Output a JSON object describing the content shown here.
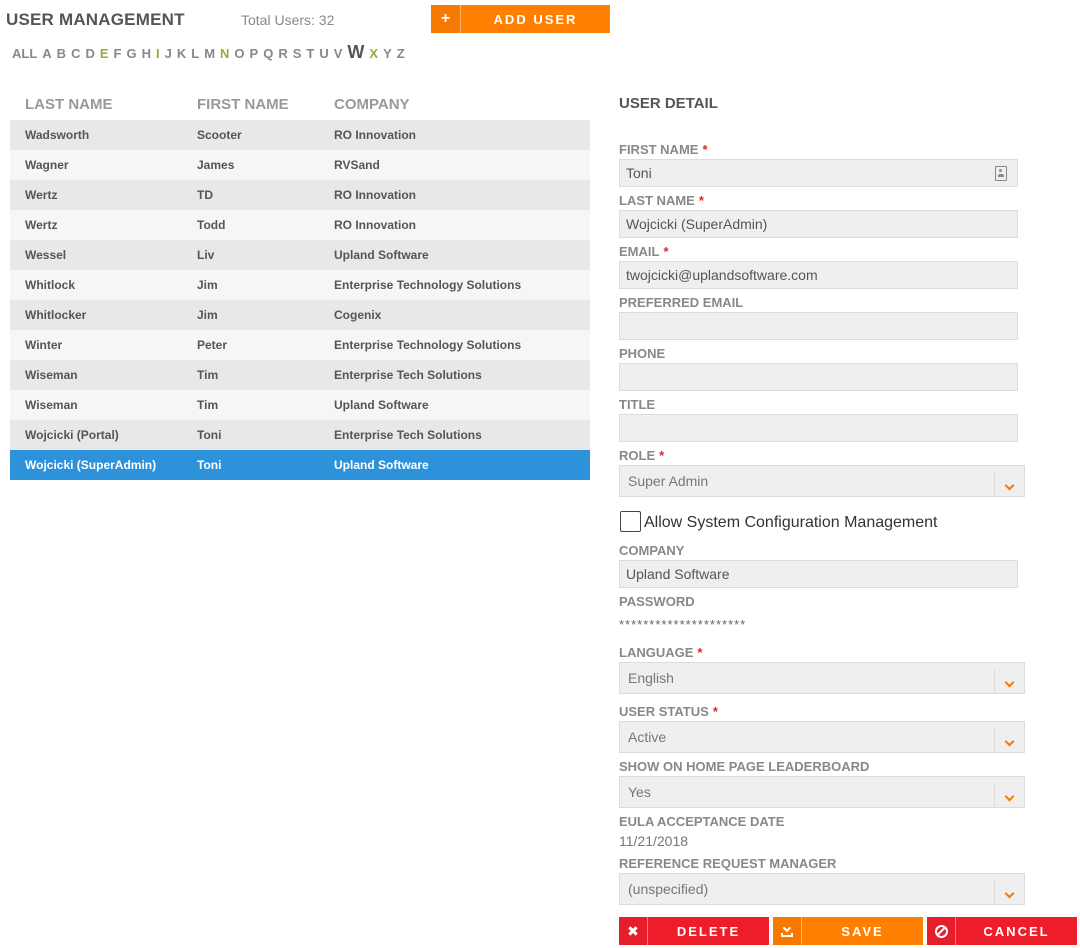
{
  "header": {
    "title": "USER MANAGEMENT",
    "total_users": "Total Users: 32",
    "add_user_icon": "+",
    "add_user_label": "ADD USER"
  },
  "alphabet": [
    {
      "letter": "ALL",
      "state": "normal"
    },
    {
      "letter": "A",
      "state": "normal"
    },
    {
      "letter": "B",
      "state": "normal"
    },
    {
      "letter": "C",
      "state": "normal"
    },
    {
      "letter": "D",
      "state": "normal"
    },
    {
      "letter": "E",
      "state": "has-users"
    },
    {
      "letter": "F",
      "state": "normal"
    },
    {
      "letter": "G",
      "state": "normal"
    },
    {
      "letter": "H",
      "state": "normal"
    },
    {
      "letter": "I",
      "state": "has-users"
    },
    {
      "letter": "J",
      "state": "normal"
    },
    {
      "letter": "K",
      "state": "normal"
    },
    {
      "letter": "L",
      "state": "normal"
    },
    {
      "letter": "M",
      "state": "normal"
    },
    {
      "letter": "N",
      "state": "has-users"
    },
    {
      "letter": "O",
      "state": "normal"
    },
    {
      "letter": "P",
      "state": "normal"
    },
    {
      "letter": "Q",
      "state": "normal"
    },
    {
      "letter": "R",
      "state": "normal"
    },
    {
      "letter": "S",
      "state": "normal"
    },
    {
      "letter": "T",
      "state": "normal"
    },
    {
      "letter": "U",
      "state": "normal"
    },
    {
      "letter": "V",
      "state": "normal"
    },
    {
      "letter": "W",
      "state": "active"
    },
    {
      "letter": "X",
      "state": "has-users"
    },
    {
      "letter": "Y",
      "state": "normal"
    },
    {
      "letter": "Z",
      "state": "normal"
    }
  ],
  "table": {
    "headers": {
      "last_name": "LAST NAME",
      "first_name": "FIRST NAME",
      "company": "COMPANY"
    },
    "rows": [
      {
        "last": "Wadsworth",
        "first": "Scooter",
        "company": "RO Innovation"
      },
      {
        "last": "Wagner",
        "first": "James",
        "company": "RVSand"
      },
      {
        "last": "Wertz",
        "first": "TD",
        "company": "RO Innovation"
      },
      {
        "last": "Wertz",
        "first": "Todd",
        "company": "RO Innovation"
      },
      {
        "last": "Wessel",
        "first": "Liv",
        "company": "Upland Software"
      },
      {
        "last": "Whitlock",
        "first": "Jim",
        "company": "Enterprise Technology Solutions"
      },
      {
        "last": "Whitlocker",
        "first": "Jim",
        "company": "Cogenix"
      },
      {
        "last": "Winter",
        "first": "Peter",
        "company": "Enterprise Technology Solutions"
      },
      {
        "last": "Wiseman",
        "first": "Tim",
        "company": "Enterprise Tech Solutions"
      },
      {
        "last": "Wiseman",
        "first": "Tim",
        "company": "Upland Software"
      },
      {
        "last": "Wojcicki (Portal)",
        "first": "Toni",
        "company": "Enterprise Tech Solutions"
      },
      {
        "last": "Wojcicki (SuperAdmin)",
        "first": "Toni",
        "company": "Upland Software",
        "selected": true
      }
    ]
  },
  "detail": {
    "title": "USER DETAIL",
    "first_name_label": "FIRST NAME",
    "first_name": "Toni",
    "last_name_label": "LAST NAME",
    "last_name": "Wojcicki (SuperAdmin)",
    "email_label": "EMAIL",
    "email": "twojcicki@uplandsoftware.com",
    "preferred_email_label": "PREFERRED EMAIL",
    "preferred_email": "",
    "phone_label": "PHONE",
    "phone": "",
    "title_label": "TITLE",
    "title_value": "",
    "role_label": "ROLE",
    "role": "Super Admin",
    "sys_config_label": "Allow System Configuration Management",
    "company_label": "COMPANY",
    "company": "Upland Software",
    "password_label": "PASSWORD",
    "password": "*********************",
    "language_label": "LANGUAGE",
    "language": "English",
    "user_status_label": "USER STATUS",
    "user_status": "Active",
    "leaderboard_label": "SHOW ON HOME PAGE LEADERBOARD",
    "leaderboard": "Yes",
    "eula_label": "EULA ACCEPTANCE DATE",
    "eula_date": "11/21/2018",
    "ref_manager_label": "REFERENCE REQUEST MANAGER",
    "ref_manager": "(unspecified)",
    "required_mark": "*"
  },
  "actions": {
    "delete_icon": "✖",
    "delete_label": "DELETE",
    "save_label": "SAVE",
    "cancel_label": "CANCEL"
  },
  "colors": {
    "accent_orange": "#ff7f00",
    "danger_red": "#ee1d2a",
    "selected_blue": "#2e92db"
  }
}
